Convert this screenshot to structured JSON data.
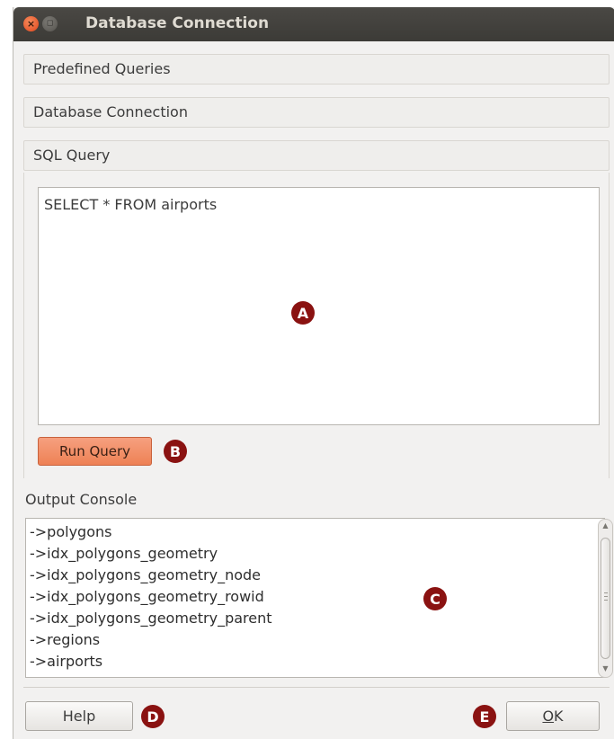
{
  "window": {
    "title": "Database Connection",
    "close_glyph": "×",
    "maximize_glyph": "◻"
  },
  "sections": {
    "predefined_queries": "Predefined Queries",
    "database_connection": "Database Connection",
    "sql_query": "SQL Query"
  },
  "sql": {
    "query_text": "SELECT * FROM airports",
    "run_label": "Run Query",
    "run_color": "#ee8155"
  },
  "console": {
    "label": "Output Console",
    "lines": [
      "->polygons",
      "->idx_polygons_geometry",
      "->idx_polygons_geometry_node",
      "->idx_polygons_geometry_rowid",
      "->idx_polygons_geometry_parent",
      "->regions",
      "->airports"
    ]
  },
  "buttons": {
    "help_label": "Help",
    "ok_label_first": "O",
    "ok_label_rest": "K"
  },
  "markers": {
    "a": "A",
    "b": "B",
    "c": "C",
    "d": "D",
    "e": "E",
    "color": "#8a1211"
  },
  "icons": {
    "close": "close-icon",
    "maximize": "maximize-icon",
    "scroll_up": "chevron-up-icon",
    "scroll_down": "chevron-down-icon"
  }
}
